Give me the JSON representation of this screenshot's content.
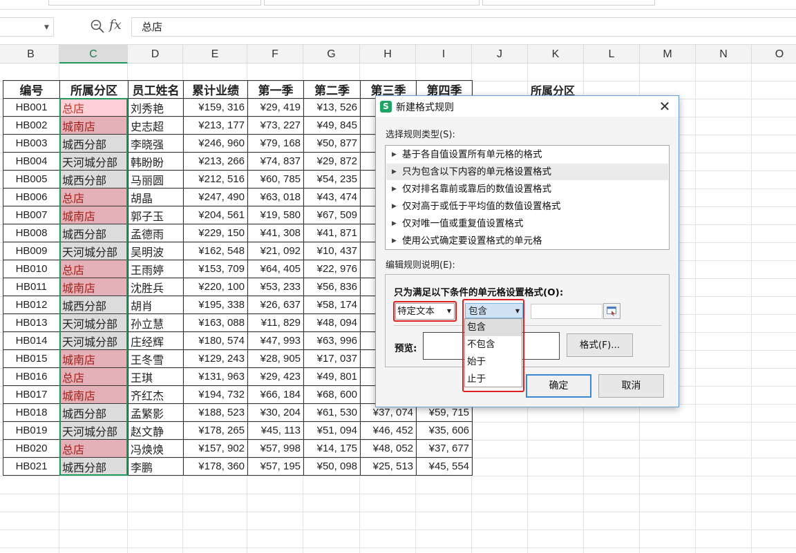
{
  "formula_bar": {
    "cell_content": "总店"
  },
  "columns": [
    {
      "letter": "B",
      "selected": false
    },
    {
      "letter": "C",
      "selected": true
    },
    {
      "letter": "D",
      "selected": false
    },
    {
      "letter": "E",
      "selected": false
    },
    {
      "letter": "F",
      "selected": false
    },
    {
      "letter": "G",
      "selected": false
    },
    {
      "letter": "H",
      "selected": false
    },
    {
      "letter": "I",
      "selected": false
    },
    {
      "letter": "J",
      "selected": false
    },
    {
      "letter": "K",
      "selected": false
    },
    {
      "letter": "L",
      "selected": false
    },
    {
      "letter": "M",
      "selected": false
    },
    {
      "letter": "N",
      "selected": false
    },
    {
      "letter": "O",
      "selected": false
    }
  ],
  "table": {
    "headers": [
      "编号",
      "所属分区",
      "员工姓名",
      "累计业绩",
      "第一季",
      "第二季",
      "第三季",
      "第四季"
    ],
    "rows": [
      [
        "HB001",
        "总店",
        "刘秀艳",
        "¥159, 316",
        "¥29, 419",
        "¥13, 526",
        "",
        ""
      ],
      [
        "HB002",
        "城南店",
        "史志超",
        "¥213, 177",
        "¥73, 227",
        "¥49, 845",
        "",
        ""
      ],
      [
        "HB003",
        "城西分部",
        "李晓强",
        "¥246, 960",
        "¥79, 168",
        "¥50, 877",
        "",
        ""
      ],
      [
        "HB004",
        "天河城分部",
        "韩盼盼",
        "¥213, 266",
        "¥74, 837",
        "¥29, 872",
        "",
        ""
      ],
      [
        "HB005",
        "城西分部",
        "马丽圆",
        "¥212, 516",
        "¥60, 785",
        "¥54, 235",
        "",
        ""
      ],
      [
        "HB006",
        "总店",
        "胡晶",
        "¥247, 490",
        "¥63, 018",
        "¥43, 474",
        "",
        ""
      ],
      [
        "HB007",
        "城南店",
        "郭子玉",
        "¥204, 561",
        "¥19, 580",
        "¥67, 509",
        "",
        ""
      ],
      [
        "HB008",
        "城西分部",
        "孟德雨",
        "¥229, 150",
        "¥41, 308",
        "¥41, 871",
        "",
        ""
      ],
      [
        "HB009",
        "天河城分部",
        "吴明波",
        "¥162, 548",
        "¥21, 092",
        "¥10, 437",
        "",
        ""
      ],
      [
        "HB010",
        "总店",
        "王雨婷",
        "¥153, 709",
        "¥64, 405",
        "¥22, 976",
        "",
        ""
      ],
      [
        "HB011",
        "城南店",
        "沈胜兵",
        "¥220, 100",
        "¥53, 233",
        "¥56, 836",
        "",
        ""
      ],
      [
        "HB012",
        "城西分部",
        "胡肖",
        "¥195, 338",
        "¥26, 637",
        "¥58, 174",
        "",
        ""
      ],
      [
        "HB013",
        "天河城分部",
        "孙立慧",
        "¥163, 088",
        "¥11, 829",
        "¥48, 094",
        "",
        ""
      ],
      [
        "HB014",
        "天河城分部",
        "庄经辉",
        "¥180, 574",
        "¥47, 993",
        "¥63, 996",
        "",
        ""
      ],
      [
        "HB015",
        "城南店",
        "王冬雪",
        "¥129, 243",
        "¥28, 905",
        "¥17, 037",
        "",
        ""
      ],
      [
        "HB016",
        "总店",
        "王琪",
        "¥131, 963",
        "¥29, 423",
        "¥49, 801",
        "",
        ""
      ],
      [
        "HB017",
        "城南店",
        "齐红杰",
        "¥194, 732",
        "¥66, 184",
        "¥68, 600",
        "",
        ""
      ],
      [
        "HB018",
        "城西分部",
        "孟繁影",
        "¥188, 523",
        "¥30, 204",
        "¥61, 530",
        "¥37, 074",
        "¥59, 715"
      ],
      [
        "HB019",
        "天河城分部",
        "赵文静",
        "¥178, 265",
        "¥45, 113",
        "¥51, 094",
        "¥46, 452",
        "¥35, 606"
      ],
      [
        "HB020",
        "总店",
        "冯焕焕",
        "¥157, 902",
        "¥57, 998",
        "¥14, 175",
        "¥48, 052",
        "¥37, 677"
      ],
      [
        "HB021",
        "城西分部",
        "李鹏",
        "¥178, 360",
        "¥57, 195",
        "¥50, 098",
        "¥25, 513",
        "¥45, 554"
      ]
    ]
  },
  "extra_header": "所属分区",
  "dialog": {
    "title": "新建格式规则",
    "close_symbol": "✕",
    "rule_type_label": "选择规则类型(S):",
    "rule_types": [
      {
        "label": "基于各自值设置所有单元格的格式",
        "selected": false
      },
      {
        "label": "只为包含以下内容的单元格设置格式",
        "selected": true
      },
      {
        "label": "仅对排名靠前或靠后的数值设置格式",
        "selected": false
      },
      {
        "label": "仅对高于或低于平均值的数值设置格式",
        "selected": false
      },
      {
        "label": "仅对唯一值或重复值设置格式",
        "selected": false
      },
      {
        "label": "使用公式确定要设置格式的单元格",
        "selected": false
      }
    ],
    "edit_desc_label": "编辑规则说明(E):",
    "condition_label": "只为满足以下条件的单元格设置格式(O):",
    "type_select": "特定文本",
    "operator_select": "包含",
    "operator_options": [
      "包含",
      "不包含",
      "始于",
      "止于"
    ],
    "operator_highlighted": 0,
    "value": "",
    "preview_label": "预览:",
    "format_button": "格式(F)...",
    "ok_button": "确定",
    "cancel_button": "取消"
  },
  "colors": {
    "selection_green": "#1f9a5f",
    "annotation_red": "#e02020",
    "conditional_fill": "#e4b1b8",
    "conditional_text": "#a4201a"
  }
}
